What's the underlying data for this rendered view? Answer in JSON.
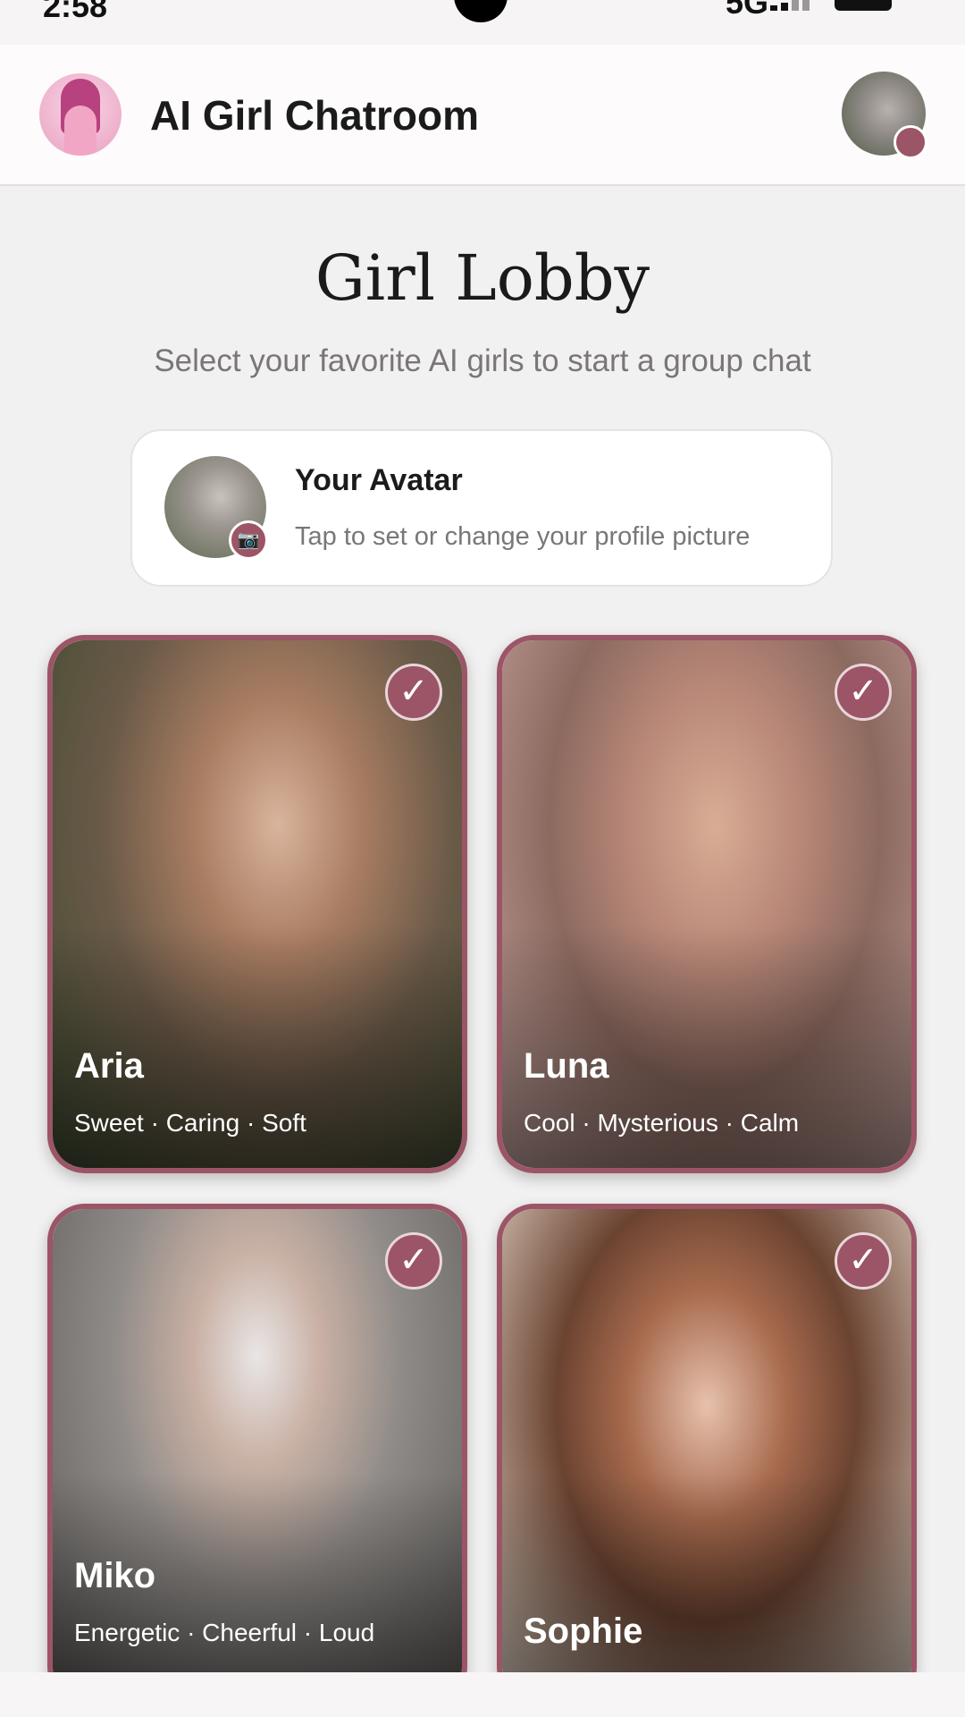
{
  "status_bar": {
    "time": "2:58",
    "signal": "5G"
  },
  "header": {
    "title": "AI Girl Chatroom"
  },
  "lobby": {
    "title": "Girl Lobby",
    "subtitle": "Select your favorite AI girls to start a group chat"
  },
  "avatar_card": {
    "title": "Your Avatar",
    "subtitle": "Tap to set or change your profile picture",
    "badge_icon": "📷"
  },
  "check_mark": "✓",
  "girls": [
    {
      "name": "Aria",
      "traits": "Sweet · Caring · Soft",
      "selected": true
    },
    {
      "name": "Luna",
      "traits": "Cool · Mysterious · Calm",
      "selected": true
    },
    {
      "name": "Miko",
      "traits": "Energetic · Cheerful · Loud",
      "selected": true
    },
    {
      "name": "Sophie",
      "traits": "",
      "selected": true
    }
  ],
  "colors": {
    "accent": "#9c5566",
    "background": "#f2f1f1"
  }
}
